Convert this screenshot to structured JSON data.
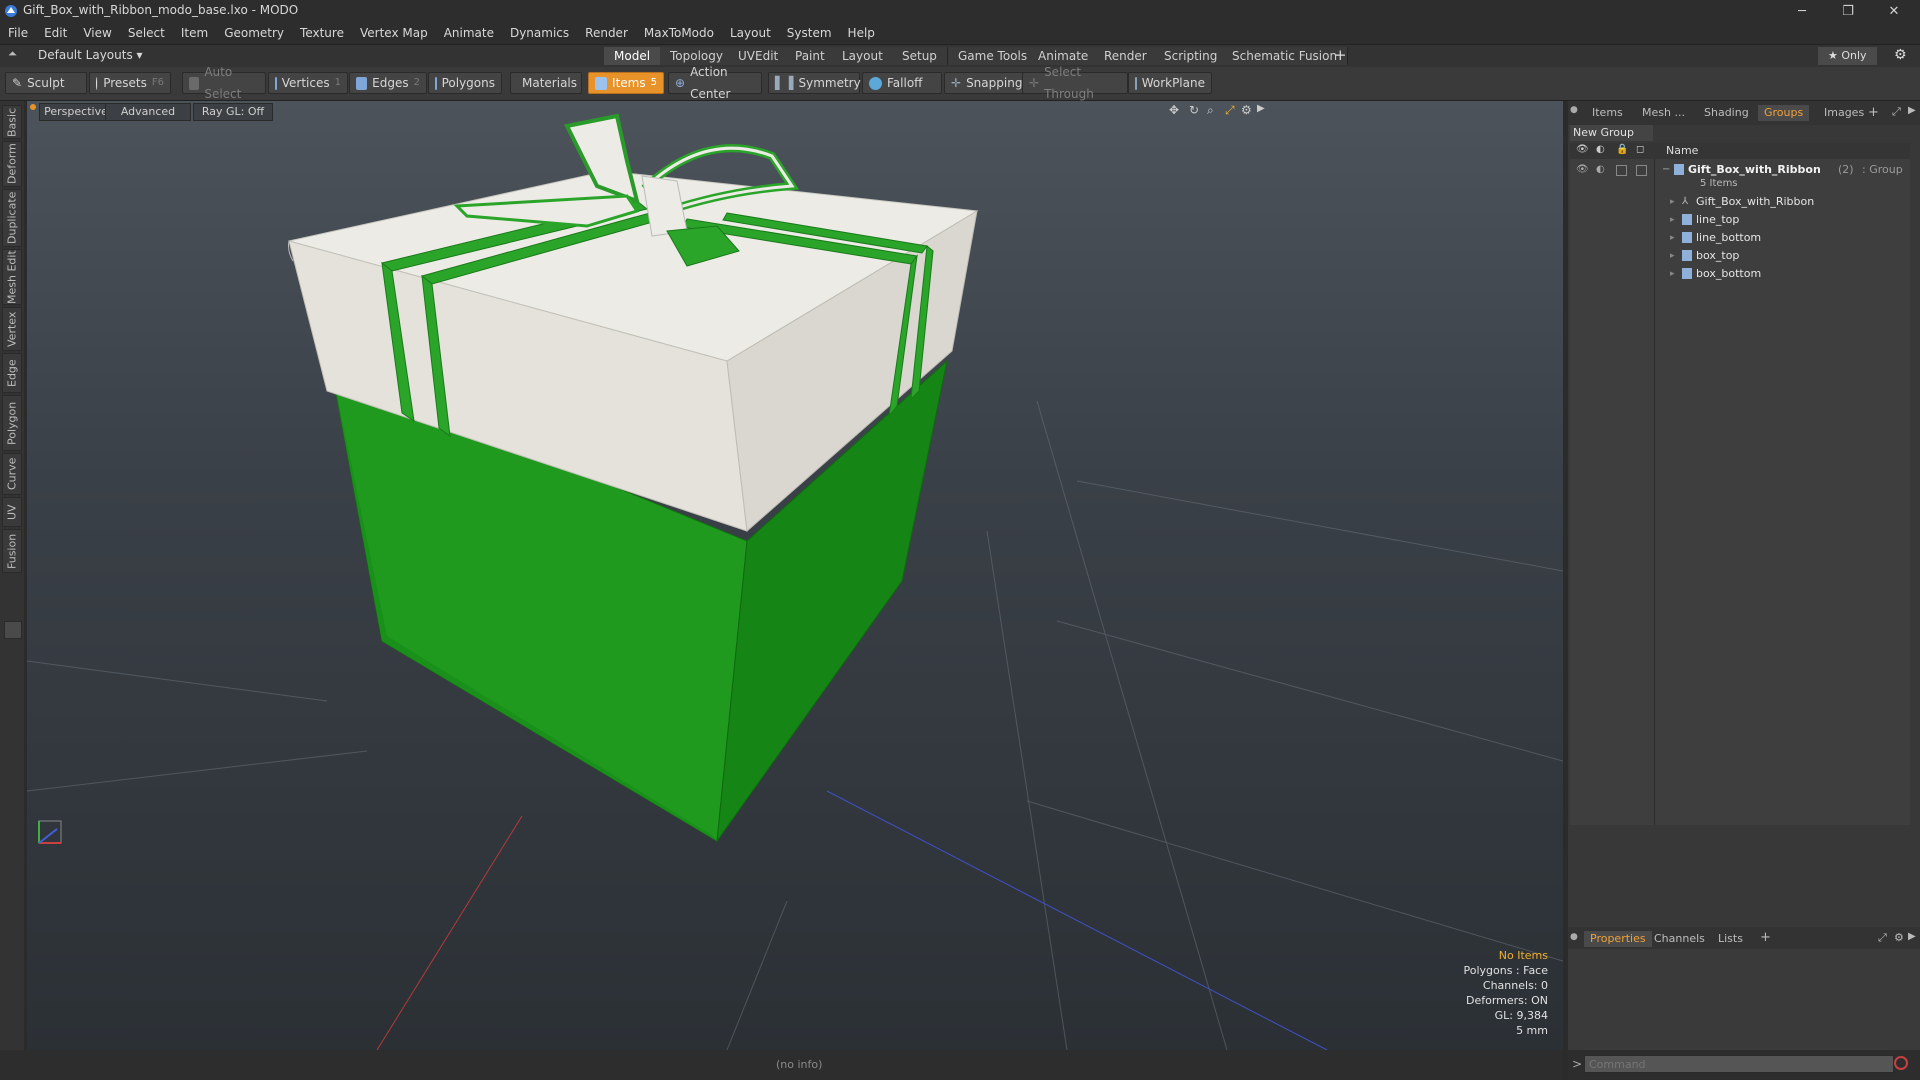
{
  "window": {
    "title": "Gift_Box_with_Ribbon_modo_base.lxo - MODO",
    "minimize": "─",
    "maximize": "❐",
    "close": "✕"
  },
  "menu": [
    "File",
    "Edit",
    "View",
    "Select",
    "Item",
    "Geometry",
    "Texture",
    "Vertex Map",
    "Animate",
    "Dynamics",
    "Render",
    "MaxToModo",
    "Layout",
    "System",
    "Help"
  ],
  "layouts": {
    "selector": "Default Layouts ▾",
    "tabs": [
      "Model",
      "Topology",
      "UVEdit",
      "Paint",
      "Layout",
      "Setup",
      "Game Tools",
      "Animate",
      "Render",
      "Scripting",
      "Schematic Fusion"
    ],
    "active": "Model",
    "add": "+",
    "only": "★  Only",
    "gear": "⚙"
  },
  "toolbar": {
    "sculpt": "Sculpt",
    "presets": "Presets",
    "presets_key": "F6",
    "auto_select": "Auto Select",
    "vertices": "Vertices",
    "vertices_key": "1",
    "edges": "Edges",
    "edges_key": "2",
    "polygons": "Polygons",
    "materials": "Materials",
    "items": "Items",
    "items_key": "5",
    "action_center": "Action Center",
    "symmetry": "Symmetry",
    "falloff": "Falloff",
    "snapping": "Snapping",
    "select_through": "Select Through",
    "workplane": "WorkPlane"
  },
  "left_tabs": [
    "Basic",
    "Deform",
    "Duplicate",
    "Mesh Edit",
    "Vertex",
    "Edge",
    "Polygon",
    "Curve",
    "UV",
    "Fusion"
  ],
  "viewport": {
    "perspective": "Perspective",
    "advanced": "Advanced",
    "raygl": "Ray GL: Off",
    "info": {
      "no_items": "No Items",
      "polygons": "Polygons : Face",
      "channels": "Channels: 0",
      "deformers": "Deformers: ON",
      "gl": "GL: 9,384",
      "unit": "5 mm"
    }
  },
  "right_panel": {
    "tabs": [
      "Items",
      "Mesh ...",
      "Shading",
      "Groups",
      "Images"
    ],
    "active_tab": "Groups",
    "add": "+",
    "new_group": "New Group",
    "column_name": "Name",
    "group": {
      "name": "Gift_Box_with_Ribbon",
      "count": "(2)",
      "type": ": Group",
      "items_count": "5 Items"
    },
    "children": [
      "Gift_Box_with_Ribbon",
      "line_top",
      "line_bottom",
      "box_top",
      "box_bottom"
    ]
  },
  "bottom_panel": {
    "tabs": [
      "Properties",
      "Channels",
      "Lists"
    ],
    "active_tab": "Properties",
    "add": "+"
  },
  "status": {
    "info": "(no info)",
    "command_placeholder": "Command",
    "prompt": ">"
  },
  "colors": {
    "accent": "#e8932a",
    "box_green": "#1f9a1f",
    "box_white": "#e6e4dc"
  }
}
